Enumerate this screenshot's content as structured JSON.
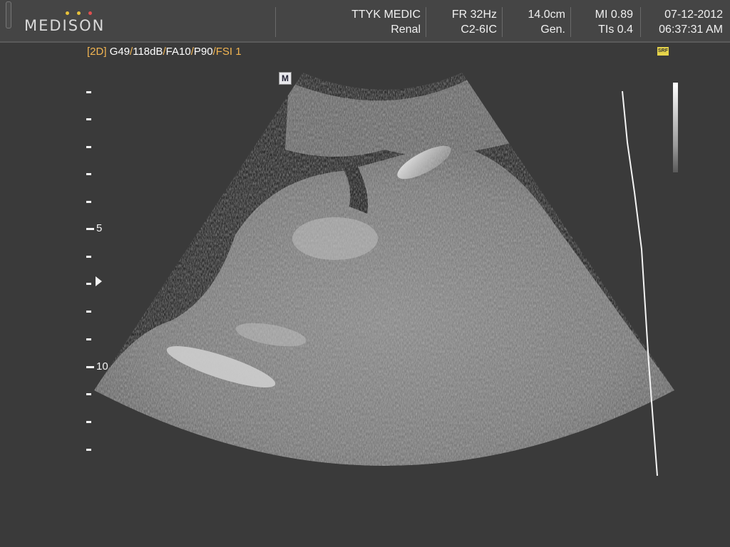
{
  "header": {
    "brand": "MEDISON",
    "brand_dot_colors": [
      "#e8c23a",
      "#e8c23a",
      "#e05050"
    ],
    "institution": "TTYK MEDIC",
    "application": "Renal",
    "frame_rate": "FR 32Hz",
    "probe": "C2-6IC",
    "depth": "14.0cm",
    "mode": "Gen.",
    "mechanical_index": "MI 0.89",
    "thermal_index": "TIs 0.4",
    "date": "07-12-2012",
    "time": "06:37:31 AM"
  },
  "imaging_params": {
    "mode_tag": "[2D]",
    "gain": "G49",
    "dynamic_range": "118dB",
    "frame_avg": "FA10",
    "power": "P90",
    "fsi": "FSI 1",
    "separator": "/"
  },
  "markers": {
    "orientation": "M",
    "srf": "SRF"
  },
  "depth_scale": {
    "label_5": "5",
    "label_10": "10"
  },
  "colors": {
    "background": "#3a3a3a",
    "accent_orange": "#f2b552",
    "text": "#f0f0f0"
  }
}
